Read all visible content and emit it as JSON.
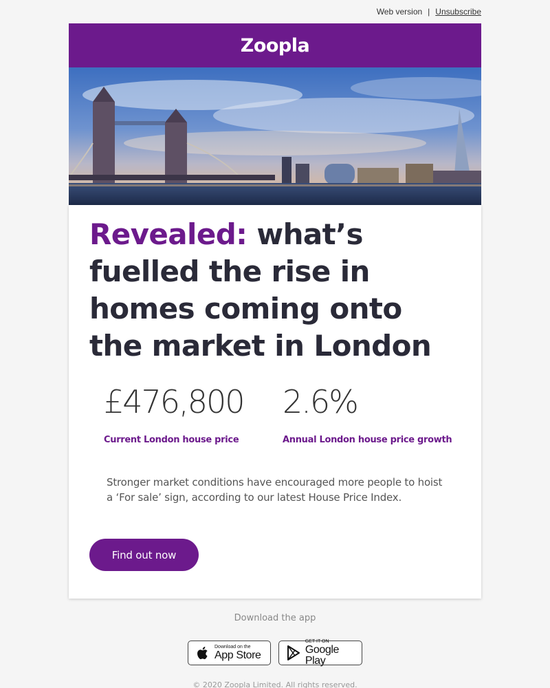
{
  "header": {
    "web_version": "Web version",
    "separator": "|",
    "unsubscribe": "Unsubscribe"
  },
  "brand": {
    "logo": "Zoopla",
    "color": "#6c1a8c"
  },
  "hero": {
    "icon": "london-skyline-image"
  },
  "article": {
    "headline_accent": "Revealed:",
    "headline_rest": " what’s fuelled the rise in homes coming onto the market in London",
    "stats": [
      {
        "value": "£476,800",
        "label": "Current London house price"
      },
      {
        "value": "2.6%",
        "label": "Annual London house price growth"
      }
    ],
    "body": "Stronger market conditions have encouraged more people to hoist a ‘For sale’ sign, according to our latest House Price Index.",
    "cta": "Find out now"
  },
  "footer": {
    "download_label": "Download the app",
    "app_store": {
      "small": "Download on the",
      "big": "App Store",
      "icon": "apple-icon"
    },
    "google_play": {
      "small": "GET IT ON",
      "big": "Google Play",
      "icon": "play-icon"
    },
    "copyright": "© 2020 Zoopla Limited. All rights reserved."
  }
}
